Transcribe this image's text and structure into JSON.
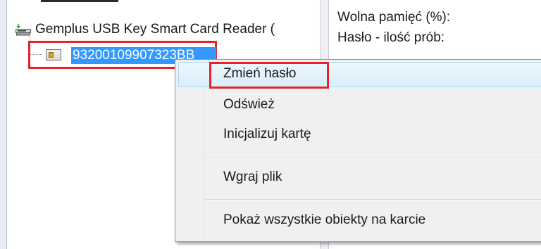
{
  "tree": {
    "reader": {
      "label": "Gemplus USB Key Smart Card Reader (",
      "icon": "card-reader-icon"
    },
    "card": {
      "label": "93200109907323BB",
      "icon": "smart-card-icon",
      "selected": true,
      "highlight_color": "#e8212b"
    }
  },
  "details": {
    "free_memory_label": "Wolna pamięć (%):",
    "pin_attempts_label": "Hasło - ilość prób:"
  },
  "context_menu": {
    "items": [
      {
        "id": "change-password",
        "label": "Zmień hasło",
        "hovered": true
      },
      {
        "id": "refresh",
        "label": "Odśwież"
      },
      {
        "id": "initialize-card",
        "label": "Inicjalizuj kartę"
      },
      {
        "id": "upload-file",
        "label": "Wgraj plik"
      },
      {
        "id": "show-all-objects",
        "label": "Pokaż wszystkie obiekty na karcie"
      }
    ]
  },
  "colors": {
    "selection": "#3399ff",
    "annotation_red": "#e8212b",
    "menu_background": "#f0f0f0"
  }
}
